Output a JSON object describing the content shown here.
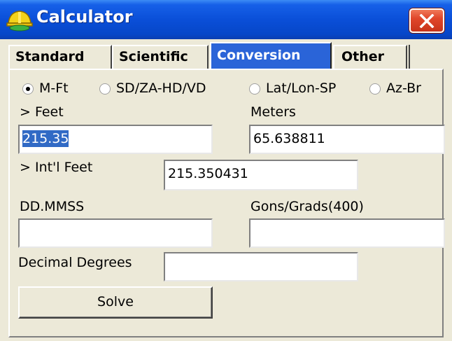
{
  "window": {
    "title": "Calculator",
    "colors": {
      "titlebar": "#0a4fd8",
      "close": "#e0462a",
      "active_tab": "#2a64d8",
      "selection": "#316ac5"
    }
  },
  "tabs": [
    {
      "label": "Standard",
      "active": false
    },
    {
      "label": "Scientific",
      "active": false
    },
    {
      "label": "Conversion",
      "active": true
    },
    {
      "label": "Other",
      "active": false
    }
  ],
  "modes": [
    {
      "label": "M-Ft",
      "checked": true
    },
    {
      "label": "SD/ZA-HD/VD",
      "checked": false
    },
    {
      "label": "Lat/Lon-SP",
      "checked": false
    },
    {
      "label": "Az-Br",
      "checked": false
    }
  ],
  "fields": {
    "feet": {
      "label": "> Feet",
      "value": "215.35",
      "selected": true
    },
    "meters": {
      "label": "Meters",
      "value": "65.638811"
    },
    "intl_feet": {
      "label": "> Int'l Feet",
      "value": "215.350431"
    },
    "dd_mmss": {
      "label": "DD.MMSS",
      "value": ""
    },
    "gons": {
      "label": "Gons/Grads(400)",
      "value": ""
    },
    "decimal_degrees": {
      "label": "Decimal Degrees",
      "value": ""
    }
  },
  "actions": {
    "solve_label": "Solve"
  }
}
